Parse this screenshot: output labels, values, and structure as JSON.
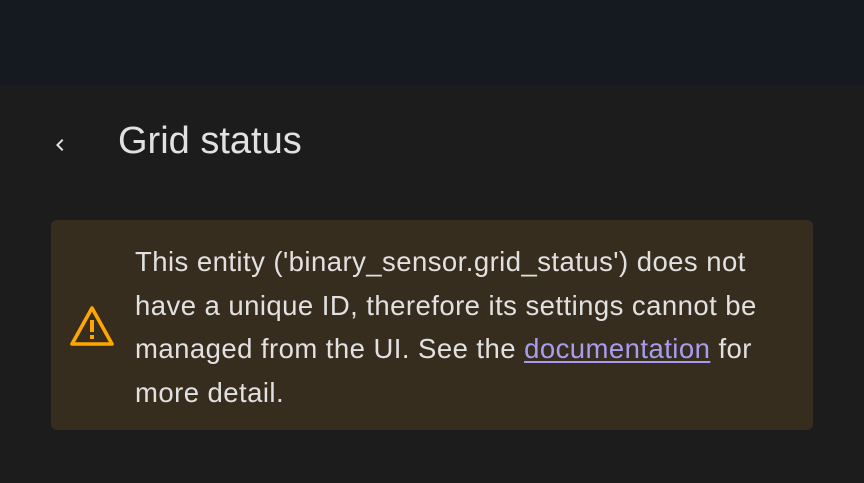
{
  "dialog": {
    "title": "Grid status",
    "back_icon": "chevron-left-icon"
  },
  "alert": {
    "icon": "warning-triangle-icon",
    "text_before": "This entity ('binary_sensor.grid_status') does not have a unique ID, therefore its settings cannot be managed from the UI. See the ",
    "link_text": "documentation",
    "text_after": " for more detail."
  },
  "colors": {
    "top_bar": "#141a1f",
    "background": "#1c1c1c",
    "alert_background": "#372d1e",
    "warning": "#ffa600",
    "link": "#a79df0",
    "text": "#e1e1e1"
  }
}
